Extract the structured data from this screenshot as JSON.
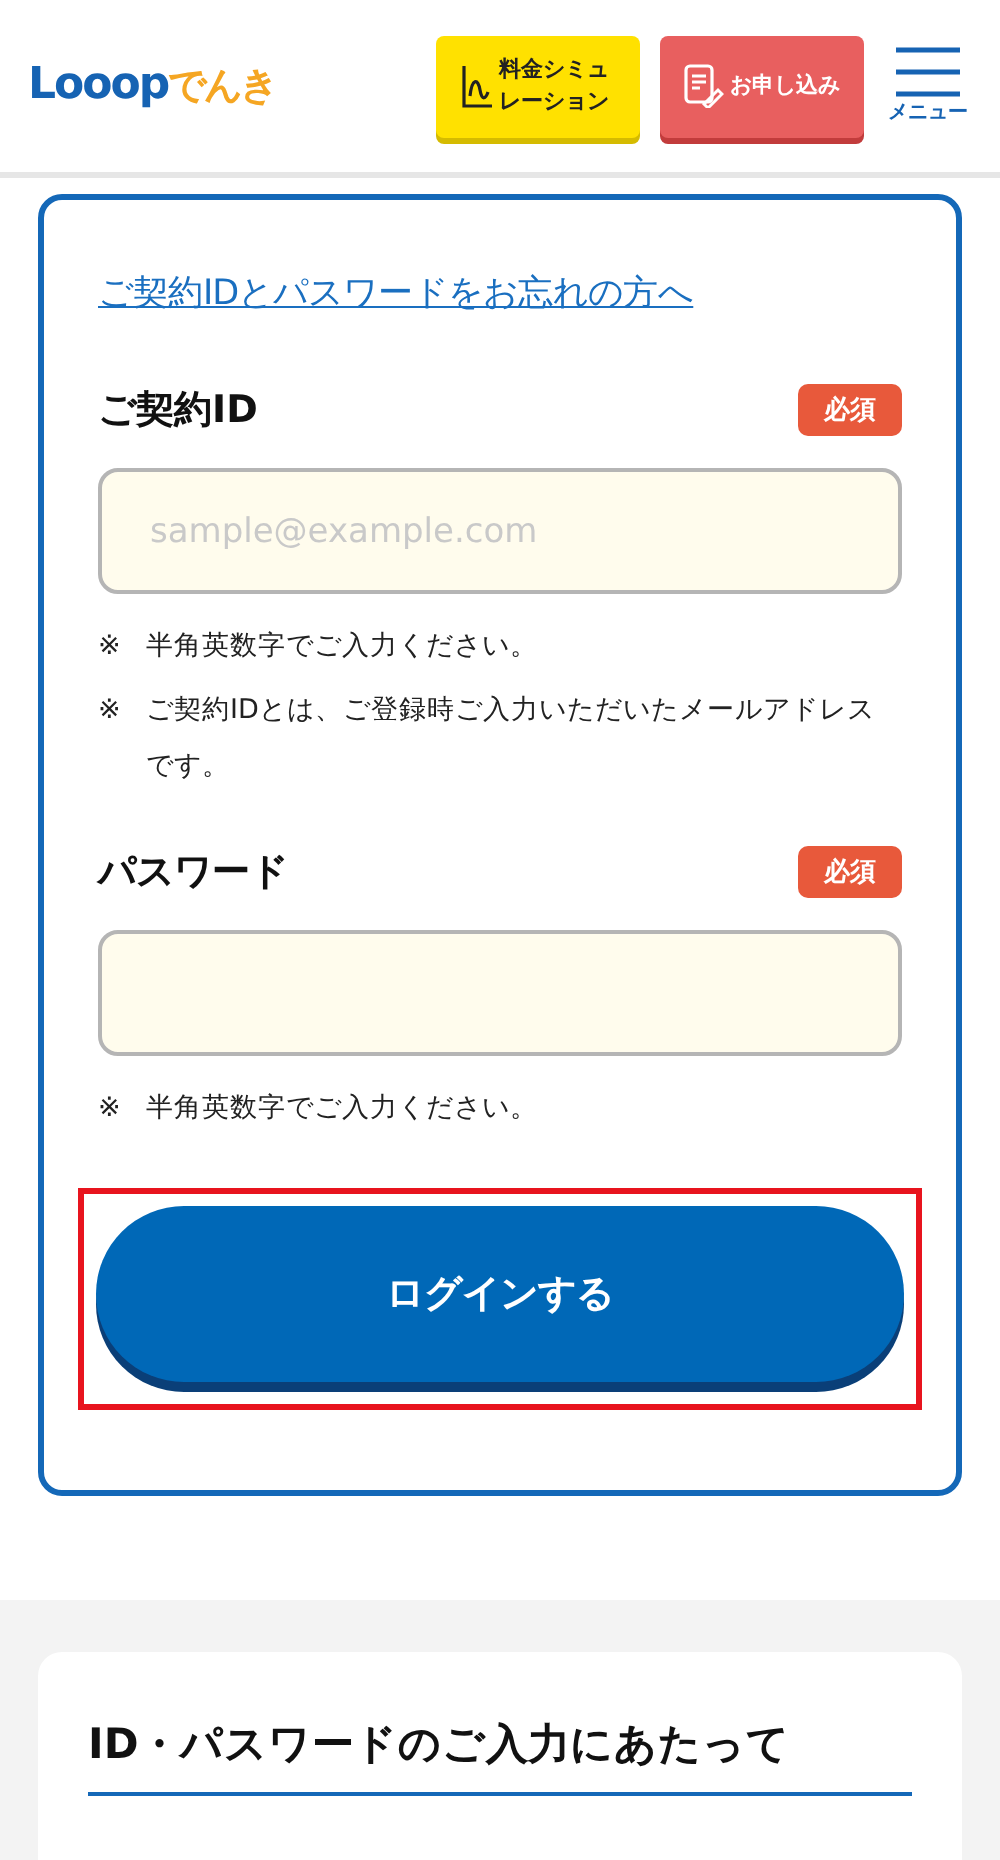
{
  "header": {
    "logo": {
      "brand": "Looop",
      "suffix": "でんき"
    },
    "buttons": [
      {
        "kind": "simulation",
        "label": "料金シミュレーション"
      },
      {
        "kind": "apply",
        "label": "お申し込み"
      }
    ],
    "menu": {
      "label": "メニュー"
    }
  },
  "login": {
    "forgot_link": "ご契約IDとパスワードをお忘れの方へ",
    "fields": [
      {
        "label": "ご契約ID",
        "badge": "必須",
        "placeholder": "sample@example.com",
        "notes": [
          {
            "mark": "※",
            "text": "半角英数字でご入力ください。"
          },
          {
            "mark": "※",
            "text": "ご契約IDとは、ご登録時ご入力いただいたメールアドレスです。"
          }
        ]
      },
      {
        "label": "パスワード",
        "badge": "必須",
        "notes": [
          {
            "mark": "※",
            "text": "半角英数字でご入力ください。"
          }
        ]
      }
    ],
    "submit": {
      "label": "ログインする",
      "highlighted": true
    }
  },
  "info": {
    "title": "ID・パスワードのご入力にあたって"
  }
}
